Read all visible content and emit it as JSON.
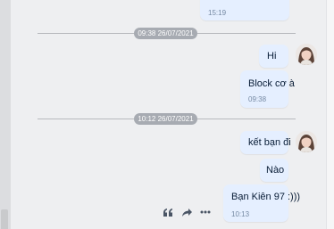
{
  "messages": [
    {
      "time": "15:19"
    },
    {
      "text": "Hi"
    },
    {
      "text": "Block cơ à",
      "time": "09:38"
    },
    {
      "text": "kết bạn đi"
    },
    {
      "text": "Nào"
    },
    {
      "text": "Bạn Kiên 97 :)))",
      "time": "10:13"
    }
  ],
  "dividers": [
    {
      "label": "09:38 26/07/2021"
    },
    {
      "label": "10:12 26/07/2021"
    }
  ],
  "message_actions": [
    "quote-icon",
    "share-icon",
    "more-icon"
  ],
  "colors": {
    "background": "#eeeff1",
    "bubble": "#e5efff",
    "time_text": "#7589a3",
    "pill": "#a7abb2"
  }
}
